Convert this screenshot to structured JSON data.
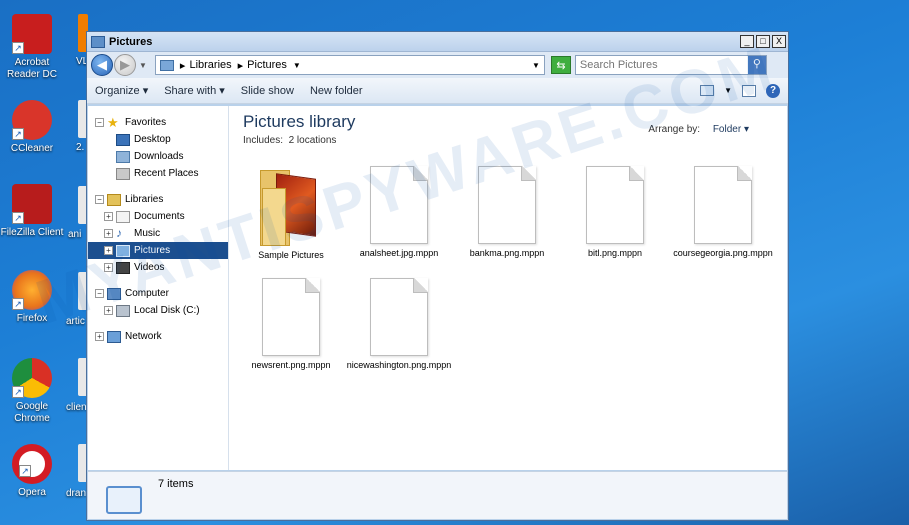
{
  "desktop": {
    "icons": [
      {
        "label": "Acrobat Reader DC",
        "icon": "acrobat-icon",
        "color": "#c81e1e"
      },
      {
        "label": "CCleaner",
        "icon": "ccleaner-icon",
        "color": "#d9352a"
      },
      {
        "label": "FileZilla Client",
        "icon": "filezilla-icon",
        "color": "#b71c1c"
      },
      {
        "label": "Firefox",
        "icon": "firefox-icon",
        "color": "#e8731b"
      },
      {
        "label": "Google Chrome",
        "icon": "chrome-icon",
        "color": "#3b9a3e"
      },
      {
        "label": "Opera",
        "icon": "opera-icon",
        "color": "#d31c24"
      }
    ],
    "partial_labels": [
      "VL",
      "2.",
      "ani",
      "artic",
      "clien",
      "dran"
    ],
    "watermark": "MYANTISPYWARE.COM"
  },
  "window": {
    "title": "Pictures",
    "controls": {
      "minimize": "_",
      "maximize": "□",
      "close": "X"
    },
    "address": {
      "crumbs": [
        "Libraries",
        "Pictures"
      ]
    },
    "search": {
      "placeholder": "Search Pictures"
    },
    "toolbar": {
      "organize": "Organize",
      "share_with": "Share with",
      "slide_show": "Slide show",
      "new_folder": "New folder"
    },
    "nav": {
      "favorites": "Favorites",
      "desktop": "Desktop",
      "downloads": "Downloads",
      "recent_places": "Recent Places",
      "libraries": "Libraries",
      "documents": "Documents",
      "music": "Music",
      "pictures": "Pictures",
      "videos": "Videos",
      "computer": "Computer",
      "local_disk": "Local Disk (C:)",
      "network": "Network"
    },
    "content": {
      "title": "Pictures library",
      "includes_label": "Includes:",
      "includes_value": "2 locations",
      "arrange_label": "Arrange by:",
      "arrange_value": "Folder",
      "files": [
        {
          "name": "Sample Pictures",
          "type": "folder"
        },
        {
          "name": "analsheet.jpg.mppn",
          "type": "file"
        },
        {
          "name": "bankma.png.mppn",
          "type": "file"
        },
        {
          "name": "bitl.png.mppn",
          "type": "file"
        },
        {
          "name": "coursegeorgia.png.mppn",
          "type": "file"
        },
        {
          "name": "newsrent.png.mppn",
          "type": "file"
        },
        {
          "name": "nicewashington.png.mppn",
          "type": "file"
        }
      ]
    },
    "status": {
      "count": "7 items"
    }
  }
}
